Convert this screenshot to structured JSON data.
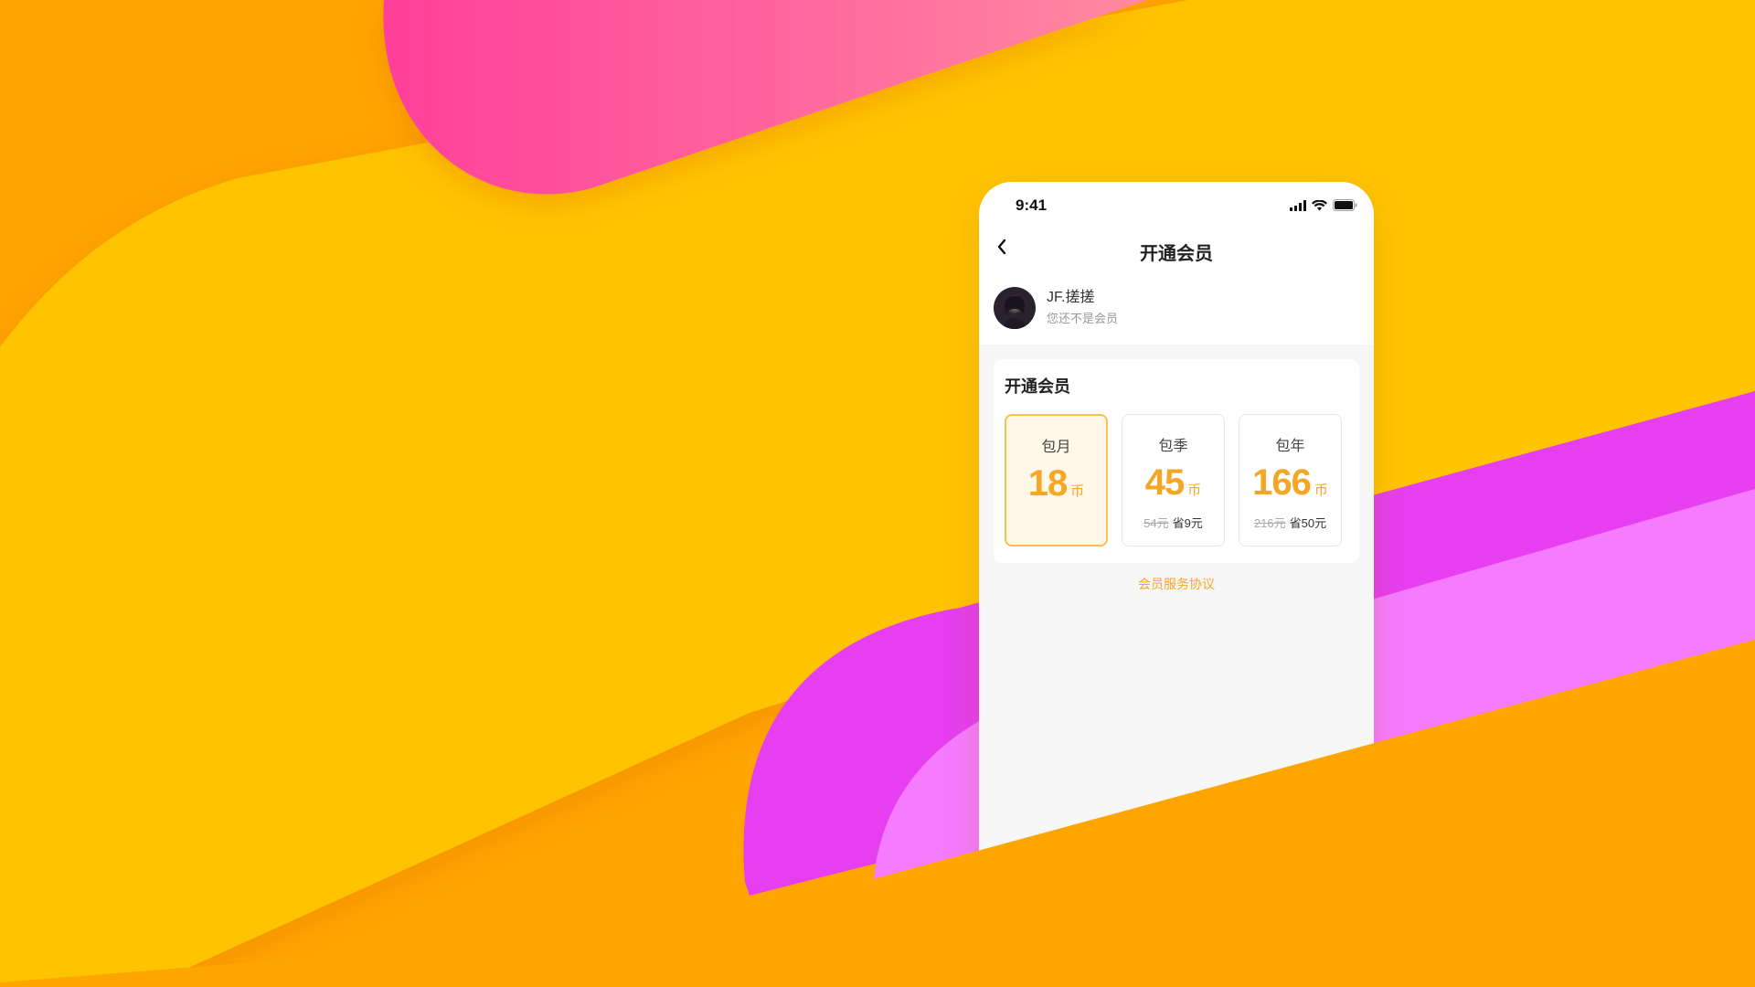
{
  "colors": {
    "background_orange": "#ffa500",
    "background_yellow": "#ffc400",
    "pink": "#ff3f9a",
    "magenta": "#e63ef0",
    "light_magenta": "#f57cff",
    "accent": "#f5a623"
  },
  "status_bar": {
    "time": "9:41",
    "icons": [
      "signal-icon",
      "wifi-icon",
      "battery-icon"
    ]
  },
  "nav": {
    "back_icon": "chevron-left-icon",
    "title": "开通会员"
  },
  "user": {
    "name": "JF.搓搓",
    "status": "您还不是会员"
  },
  "membership": {
    "title": "开通会员",
    "plans": [
      {
        "name": "包月",
        "price": "18",
        "unit": "币",
        "original": "",
        "saving": "",
        "selected": true
      },
      {
        "name": "包季",
        "price": "45",
        "unit": "币",
        "original": "54元",
        "saving": "省9元",
        "selected": false
      },
      {
        "name": "包年",
        "price": "166",
        "unit": "币",
        "original": "216元",
        "saving": "省50元",
        "selected": false
      }
    ]
  },
  "footer": {
    "agreement_link": "会员服务协议"
  }
}
